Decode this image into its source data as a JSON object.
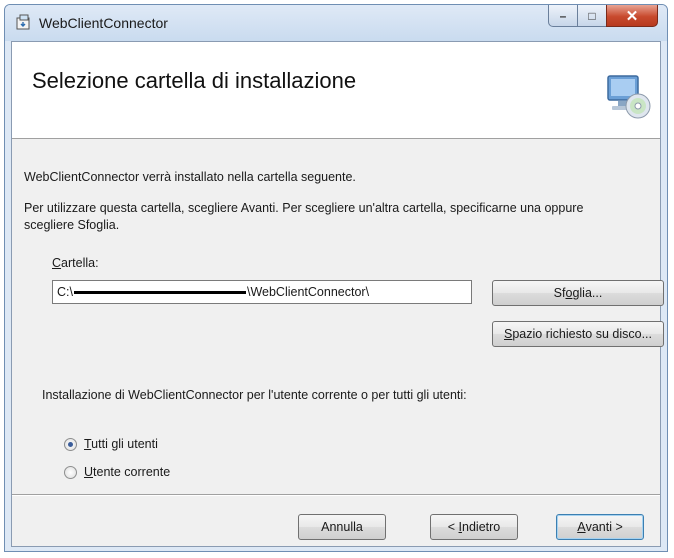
{
  "window": {
    "title": "WebClientConnector",
    "minimize_label": "–",
    "maximize_label": "□",
    "close_label": "✕"
  },
  "header": {
    "title": "Selezione cartella di installazione"
  },
  "body": {
    "intro": "WebClientConnector verrà installato nella cartella seguente.",
    "instructions": "Per utilizzare questa cartella, scegliere Avanti. Per scegliere un'altra cartella, specificarne una oppure scegliere Sfoglia.",
    "folder_label_access": "C",
    "folder_label_rest": "artella:",
    "folder_path_prefix": "C:\\",
    "folder_path_suffix": "\\WebClientConnector\\",
    "browse_pre": "Sf",
    "browse_access": "o",
    "browse_post": "glia...",
    "disk_access": "S",
    "disk_rest": "pazio richiesto su disco...",
    "scope_question": "Installazione di WebClientConnector per l'utente corrente o per tutti gli utenti:",
    "radio_all_access": "T",
    "radio_all_rest": "utti gli utenti",
    "radio_all_selected": true,
    "radio_current_access": "U",
    "radio_current_rest": "tente corrente",
    "radio_current_selected": false
  },
  "footer": {
    "cancel_label": "Annulla",
    "back_pre": "< ",
    "back_access": "I",
    "back_rest": "ndietro",
    "next_access": "A",
    "next_rest": "vanti >"
  },
  "colors": {
    "window_frame": "#dde8f5",
    "close_button": "#c84a2e",
    "dialog_background": "#f0f0f0",
    "banner_background": "#ffffff"
  },
  "icons": {
    "app": "installer-icon",
    "banner": "computer-disc-icon"
  }
}
